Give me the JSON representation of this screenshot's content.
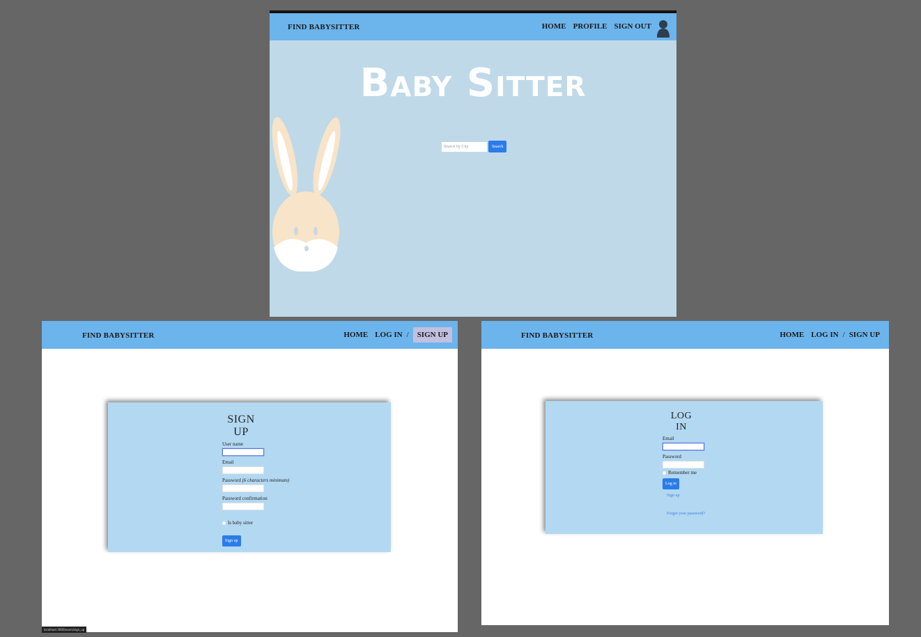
{
  "home": {
    "brand": "FIND BABYSITTER",
    "nav": {
      "home": "HOME",
      "profile": "PROFILE",
      "sign_out": "SIGN OUT"
    },
    "hero_title": "Baby Sitter",
    "search": {
      "placeholder": "Search by City",
      "button": "Search"
    }
  },
  "signup": {
    "brand": "FIND BABYSITTER",
    "nav": {
      "home": "HOME",
      "log_in": "LOG IN",
      "separator": "/",
      "sign_up": "SIGN UP"
    },
    "title": "SIGN UP",
    "fields": {
      "user_name": "User name",
      "email": "Email",
      "password": "Password",
      "password_hint": "(6 characters minimum)",
      "password_confirmation": "Password confirmation"
    },
    "is_baby_sitter": "Is baby sitter",
    "submit": "Sign up"
  },
  "login": {
    "brand": "FIND BABYSITTER",
    "nav": {
      "home": "HOME",
      "log_in": "LOG IN",
      "separator": "/",
      "sign_up": "SIGN UP"
    },
    "title": "LOG IN",
    "fields": {
      "email": "Email",
      "password": "Password"
    },
    "remember_me": "Remember me",
    "submit": "Log in",
    "links": {
      "sign_up": "Sign up",
      "forgot": "Forgot your password?"
    }
  },
  "status_bar": "localhost:3000/users/sign_up",
  "colors": {
    "navbar": "#6cb4ec",
    "hero_bg": "#bfd9e8",
    "card_bg": "#b3d8f2",
    "primary": "#2b7ce9",
    "active_nav": "#c2bfe0"
  },
  "icons": {
    "avatar": "user-silhouette-icon",
    "bunny": "bunny-illustration"
  }
}
